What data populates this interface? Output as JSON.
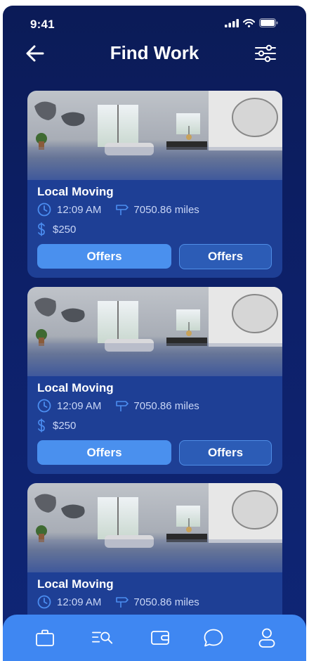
{
  "status_bar": {
    "time": "9:41"
  },
  "header": {
    "title": "Find Work"
  },
  "jobs": [
    {
      "name": "Local Moving",
      "time": "12:09 AM",
      "distance": "7050.86 miles",
      "price": "$250",
      "primary_button": "Offers",
      "secondary_button": "Offers"
    },
    {
      "name": "Local Moving",
      "time": "12:09 AM",
      "distance": "7050.86 miles",
      "price": "$250",
      "primary_button": "Offers",
      "secondary_button": "Offers"
    },
    {
      "name": "Local Moving",
      "time": "12:09 AM",
      "distance": "7050.86 miles"
    }
  ],
  "nav": {
    "items": [
      {
        "icon": "briefcase-icon"
      },
      {
        "icon": "search-list-icon"
      },
      {
        "icon": "wallet-icon"
      },
      {
        "icon": "chat-icon"
      },
      {
        "icon": "profile-icon"
      }
    ]
  },
  "colors": {
    "background": "#0d2069",
    "card": "#1e3f95",
    "accent": "#4a90ee",
    "nav": "#3f87f2"
  }
}
